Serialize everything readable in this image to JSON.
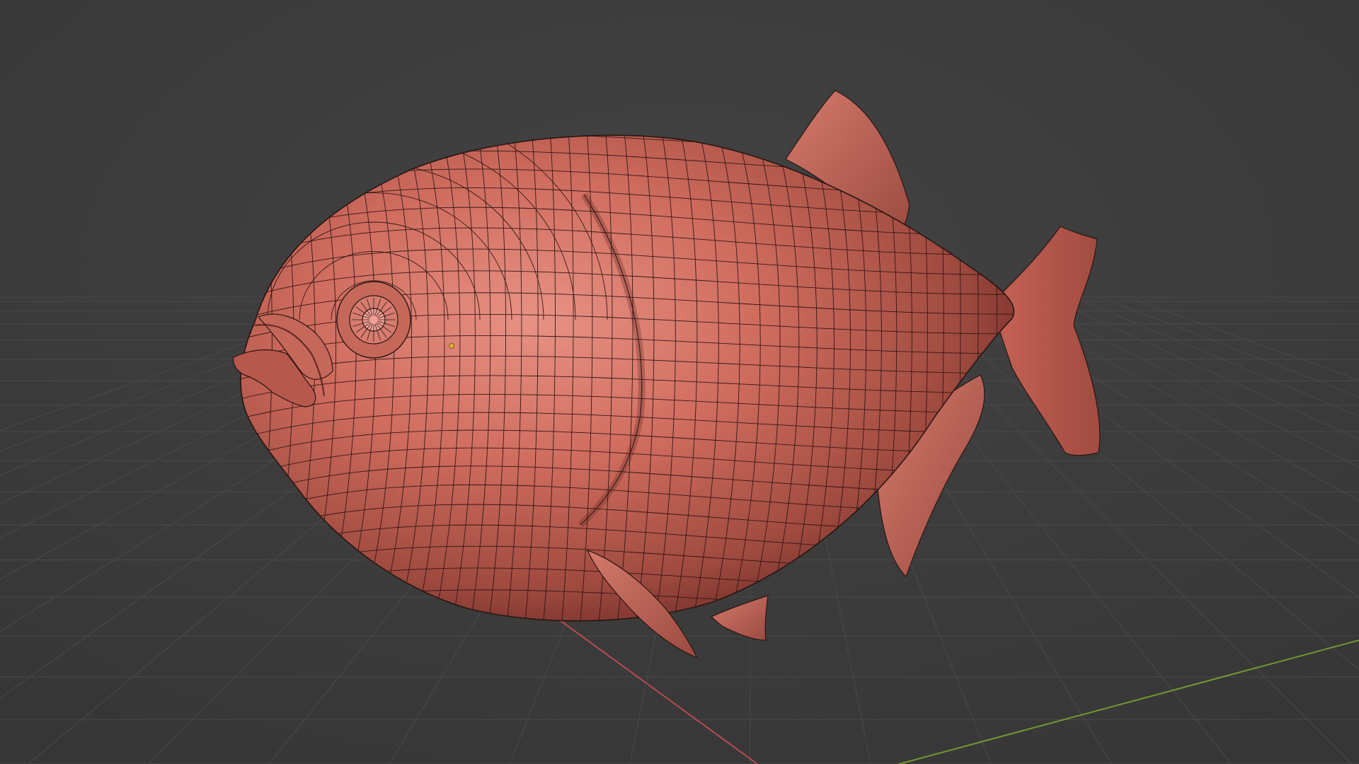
{
  "viewport": {
    "background_color": "#3a3a3a",
    "grid_color": "#4a4a4a",
    "x_axis_color": "#b84a52",
    "y_axis_color": "#6f9a2d"
  },
  "mesh": {
    "subject": "piranha",
    "surface_color": "#c8675a",
    "highlight_color": "#e08d80",
    "shadow_color": "#7d3a31",
    "wireframe_color": "#2a1512",
    "origin_color": "#e6b13a"
  },
  "icons": {
    "origin": "object-origin-icon"
  }
}
